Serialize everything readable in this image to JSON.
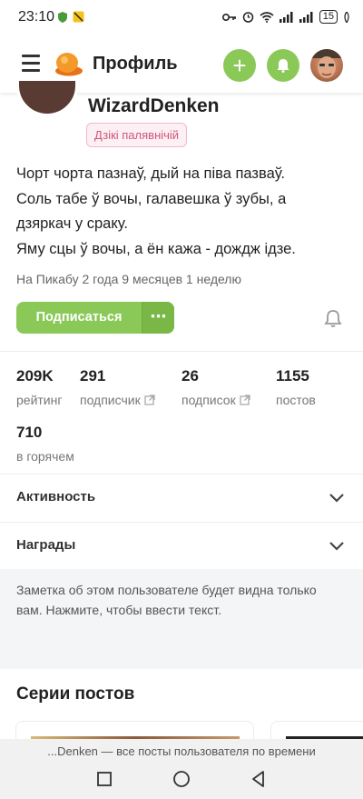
{
  "status_bar": {
    "time": "23:10",
    "battery": "15"
  },
  "header": {
    "title": "Профиль",
    "add_label": "+"
  },
  "profile": {
    "username": "WizardDenken",
    "badge": "Дзікі палявнічій",
    "bio": [
      "Чорт чорта пазнаў, дый на піва пазваў.",
      "Соль табе ў вочы, галавешка ў зубы, а",
      "дзяркач у сраку.",
      "Яму сцы ў вочы, а ён кажа - дождж ідзе."
    ],
    "since": "На Пикабу 2 года 9 месяцев 1 неделю",
    "subscribe_label": "Подписаться",
    "more_label": "⋯"
  },
  "stats": [
    {
      "value": "209K",
      "label": "рейтинг"
    },
    {
      "value": "291",
      "label": "подписчик"
    },
    {
      "value": "26",
      "label": "подписок"
    },
    {
      "value": "1155",
      "label": "постов"
    },
    {
      "value": "710",
      "label": "в горячем"
    }
  ],
  "sections": {
    "activity": "Активность",
    "awards": "Награды"
  },
  "note": {
    "text": "Заметка об этом пользователе будет видна только вам. Нажмите, чтобы ввести текст."
  },
  "series": {
    "title": "Серии постов"
  },
  "bottom": {
    "text": "...Denken — все посты пользователя по времени"
  },
  "colors": {
    "accent_green": "#8ac858",
    "badge_pink": "#d0557a"
  }
}
